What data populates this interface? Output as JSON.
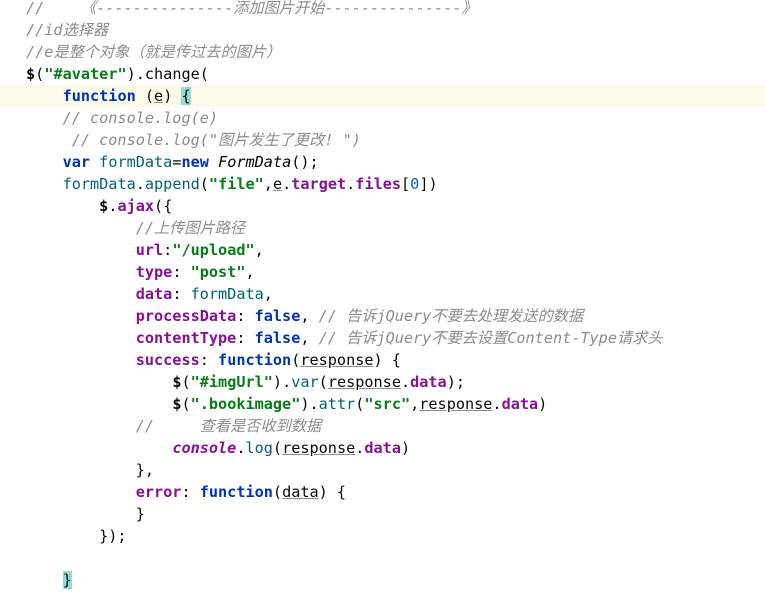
{
  "colors": {
    "comment": "#8c8c8c",
    "keyword": "#0033b3",
    "string": "#067d17",
    "prop": "#871094",
    "var": "#00627a",
    "fn": "#00627a",
    "cls": "#000000",
    "num": "#1750eb",
    "bracematch": "#93d9d9"
  },
  "editor": {
    "lines": [
      {
        "tokens": [
          {
            "c": "comment",
            "t": "//    《---------------添加图片开始---------------》"
          }
        ]
      },
      {
        "tokens": [
          {
            "c": "comment",
            "t": "//id选择器"
          }
        ]
      },
      {
        "tokens": [
          {
            "c": "comment",
            "t": "//e是整个对象（就是传过去的图片）"
          }
        ]
      },
      {
        "tokens": [
          {
            "c": "dollar",
            "t": "$"
          },
          {
            "c": "plain",
            "t": "("
          },
          {
            "c": "string",
            "t": "\"#avater\""
          },
          {
            "c": "plain",
            "t": ").change("
          }
        ]
      },
      {
        "current": true,
        "tokens": [
          {
            "c": "plain",
            "t": "    "
          },
          {
            "c": "keyword",
            "t": "function"
          },
          {
            "c": "plain",
            "t": " ("
          },
          {
            "c": "param",
            "t": "e"
          },
          {
            "c": "plain",
            "t": ") "
          },
          {
            "c": "brace",
            "t": "{"
          }
        ]
      },
      {
        "tokens": [
          {
            "c": "plain",
            "t": "    "
          },
          {
            "c": "comment",
            "t": "// console.log(e)"
          }
        ]
      },
      {
        "tokens": [
          {
            "c": "plain",
            "t": "     "
          },
          {
            "c": "comment",
            "t": "// console.log(\"图片发生了更改! \")"
          }
        ]
      },
      {
        "tokens": [
          {
            "c": "plain",
            "t": "    "
          },
          {
            "c": "keyword",
            "t": "var"
          },
          {
            "c": "plain",
            "t": " "
          },
          {
            "c": "var",
            "t": "formData"
          },
          {
            "c": "plain",
            "t": "="
          },
          {
            "c": "keyword",
            "t": "new"
          },
          {
            "c": "plain",
            "t": " "
          },
          {
            "c": "class",
            "t": "FormData"
          },
          {
            "c": "plain",
            "t": "();"
          }
        ]
      },
      {
        "tokens": [
          {
            "c": "plain",
            "t": "    "
          },
          {
            "c": "var",
            "t": "formData"
          },
          {
            "c": "plain",
            "t": "."
          },
          {
            "c": "fn",
            "t": "append"
          },
          {
            "c": "plain",
            "t": "("
          },
          {
            "c": "string",
            "t": "\"file\""
          },
          {
            "c": "plain",
            "t": ","
          },
          {
            "c": "paramu",
            "t": "e"
          },
          {
            "c": "plain",
            "t": "."
          },
          {
            "c": "prop",
            "t": "target"
          },
          {
            "c": "plain",
            "t": "."
          },
          {
            "c": "prop",
            "t": "files"
          },
          {
            "c": "plain",
            "t": "["
          },
          {
            "c": "num",
            "t": "0"
          },
          {
            "c": "plain",
            "t": "])"
          }
        ]
      },
      {
        "tokens": [
          {
            "c": "plain",
            "t": "        "
          },
          {
            "c": "dollar",
            "t": "$"
          },
          {
            "c": "plain",
            "t": "."
          },
          {
            "c": "prop",
            "t": "ajax"
          },
          {
            "c": "plain",
            "t": "({"
          }
        ]
      },
      {
        "tokens": [
          {
            "c": "plain",
            "t": "            "
          },
          {
            "c": "comment",
            "t": "//上传图片路径"
          }
        ]
      },
      {
        "tokens": [
          {
            "c": "plain",
            "t": "            "
          },
          {
            "c": "prop",
            "t": "url"
          },
          {
            "c": "plain",
            "t": ":"
          },
          {
            "c": "string",
            "t": "\"/upload\""
          },
          {
            "c": "plain",
            "t": ","
          }
        ]
      },
      {
        "tokens": [
          {
            "c": "plain",
            "t": "            "
          },
          {
            "c": "prop",
            "t": "type"
          },
          {
            "c": "plain",
            "t": ": "
          },
          {
            "c": "string",
            "t": "\"post\""
          },
          {
            "c": "plain",
            "t": ","
          }
        ]
      },
      {
        "tokens": [
          {
            "c": "plain",
            "t": "            "
          },
          {
            "c": "prop",
            "t": "data"
          },
          {
            "c": "plain",
            "t": ": "
          },
          {
            "c": "var",
            "t": "formData"
          },
          {
            "c": "plain",
            "t": ","
          }
        ]
      },
      {
        "tokens": [
          {
            "c": "plain",
            "t": "            "
          },
          {
            "c": "prop",
            "t": "processData"
          },
          {
            "c": "plain",
            "t": ": "
          },
          {
            "c": "keyword",
            "t": "false"
          },
          {
            "c": "plain",
            "t": ", "
          },
          {
            "c": "comment",
            "t": "// 告诉jQuery不要去处理发送的数据"
          }
        ]
      },
      {
        "tokens": [
          {
            "c": "plain",
            "t": "            "
          },
          {
            "c": "prop",
            "t": "contentType"
          },
          {
            "c": "plain",
            "t": ": "
          },
          {
            "c": "keyword",
            "t": "false"
          },
          {
            "c": "plain",
            "t": ", "
          },
          {
            "c": "comment",
            "t": "// 告诉jQuery不要去设置Content-Type请求头"
          }
        ]
      },
      {
        "tokens": [
          {
            "c": "plain",
            "t": "            "
          },
          {
            "c": "prop",
            "t": "success"
          },
          {
            "c": "plain",
            "t": ": "
          },
          {
            "c": "keyword",
            "t": "function"
          },
          {
            "c": "plain",
            "t": "("
          },
          {
            "c": "paramu",
            "t": "response"
          },
          {
            "c": "plain",
            "t": ") {"
          }
        ]
      },
      {
        "tokens": [
          {
            "c": "plain",
            "t": "                "
          },
          {
            "c": "dollar",
            "t": "$"
          },
          {
            "c": "plain",
            "t": "("
          },
          {
            "c": "string",
            "t": "\"#imgUrl\""
          },
          {
            "c": "plain",
            "t": ")."
          },
          {
            "c": "fn",
            "t": "var"
          },
          {
            "c": "plain",
            "t": "("
          },
          {
            "c": "paramu",
            "t": "response"
          },
          {
            "c": "plain",
            "t": "."
          },
          {
            "c": "prop",
            "t": "data"
          },
          {
            "c": "plain",
            "t": ");"
          }
        ]
      },
      {
        "tokens": [
          {
            "c": "plain",
            "t": "                "
          },
          {
            "c": "dollar",
            "t": "$"
          },
          {
            "c": "plain",
            "t": "("
          },
          {
            "c": "string",
            "t": "\".bookimage\""
          },
          {
            "c": "plain",
            "t": ")."
          },
          {
            "c": "fn",
            "t": "attr"
          },
          {
            "c": "plain",
            "t": "("
          },
          {
            "c": "string",
            "t": "\"src\""
          },
          {
            "c": "plain",
            "t": ","
          },
          {
            "c": "paramu",
            "t": "response"
          },
          {
            "c": "plain",
            "t": "."
          },
          {
            "c": "prop",
            "t": "data"
          },
          {
            "c": "plain",
            "t": ")"
          }
        ]
      },
      {
        "tokens": [
          {
            "c": "plain",
            "t": "            "
          },
          {
            "c": "comment",
            "t": "//     查看是否收到数据"
          }
        ]
      },
      {
        "tokens": [
          {
            "c": "plain",
            "t": "                "
          },
          {
            "c": "italicfn",
            "t": "console"
          },
          {
            "c": "plain",
            "t": "."
          },
          {
            "c": "fn",
            "t": "log"
          },
          {
            "c": "plain",
            "t": "("
          },
          {
            "c": "paramu",
            "t": "response"
          },
          {
            "c": "plain",
            "t": "."
          },
          {
            "c": "prop",
            "t": "data"
          },
          {
            "c": "plain",
            "t": ")"
          }
        ]
      },
      {
        "tokens": [
          {
            "c": "plain",
            "t": "            },"
          }
        ]
      },
      {
        "tokens": [
          {
            "c": "plain",
            "t": "            "
          },
          {
            "c": "prop",
            "t": "error"
          },
          {
            "c": "plain",
            "t": ": "
          },
          {
            "c": "keyword",
            "t": "function"
          },
          {
            "c": "plain",
            "t": "("
          },
          {
            "c": "paramu",
            "t": "data"
          },
          {
            "c": "plain",
            "t": ") {"
          }
        ]
      },
      {
        "tokens": [
          {
            "c": "plain",
            "t": "            }"
          }
        ]
      },
      {
        "tokens": [
          {
            "c": "plain",
            "t": "        });"
          }
        ]
      },
      {
        "tokens": [
          {
            "c": "plain",
            "t": ""
          }
        ]
      },
      {
        "tokens": [
          {
            "c": "plain",
            "t": "    "
          },
          {
            "c": "brace",
            "t": "}"
          }
        ]
      }
    ]
  }
}
